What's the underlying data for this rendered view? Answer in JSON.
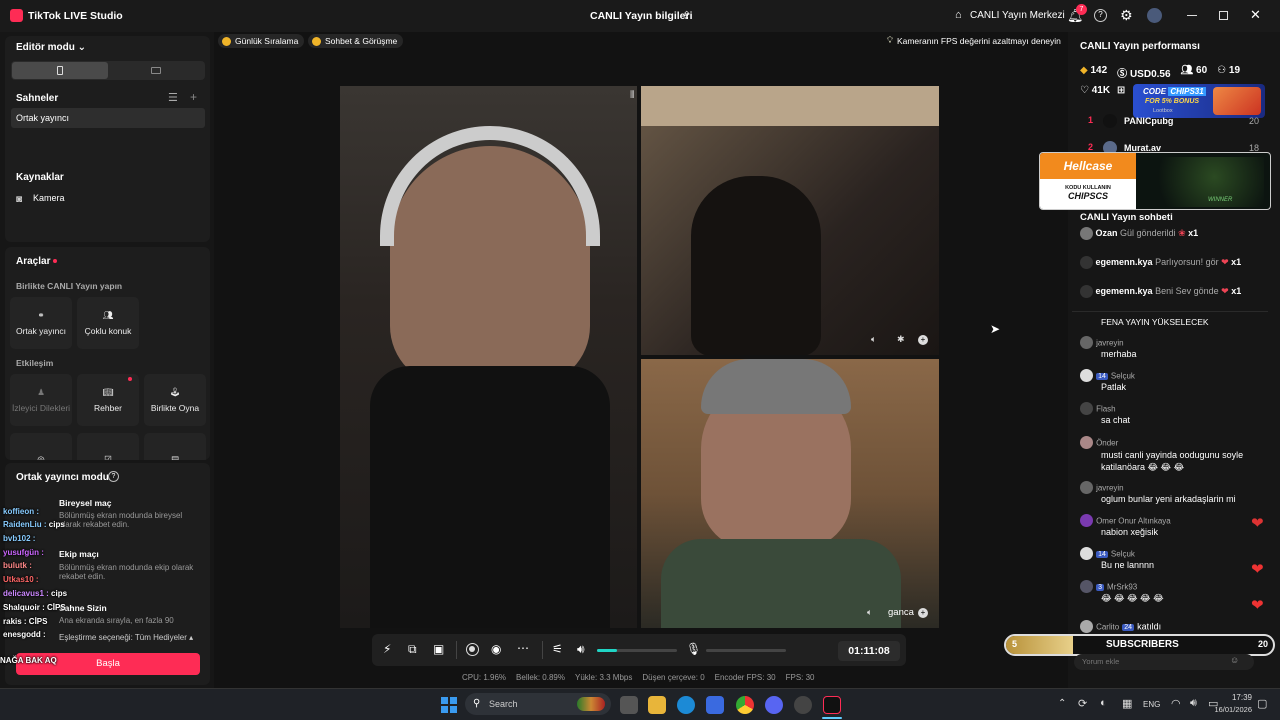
{
  "app": {
    "title": "TikTok LIVE Studio",
    "center_title": "CANLI Yayın bilgileri",
    "live_center": "CANLI Yayın Merkezi",
    "notif_count": "7"
  },
  "left": {
    "editor_mode": "Editör modu",
    "scenes_title": "Sahneler",
    "scene_item": "Ortak yayıncı",
    "sources_title": "Kaynaklar",
    "source_camera": "Kamera",
    "tools_title": "Araçlar",
    "tools_subtitle": "Birlikte CANLI Yayın yapın",
    "tool_cohost": "Ortak yayıncı",
    "tool_multi": "Çoklu konuk",
    "interaction_title": "Etkileşim",
    "tool_requests": "İzleyici Dilekleri",
    "tool_guide": "Rehber",
    "tool_play": "Birlikte Oyna",
    "cohost_mode": "Ortak yayıncı modu",
    "solo_match": "Bireysel maç",
    "solo_desc": "Bölünmüş ekran modunda bireysel olarak rekabet edin.",
    "team_match": "Ekip maçı",
    "team_desc": "Bölünmüş ekran modunda ekip olarak rekabet edin.",
    "arena": "Sahne Sizin",
    "arena_desc": "Ana ekranda sırayla, en fazla 90",
    "match_option": "Eşleştirme seçeneği: Tüm Hediyeler",
    "start": "Başla"
  },
  "overlay_chat": [
    {
      "user": "koffieon",
      "text": ""
    },
    {
      "user": "RaidenLiu",
      "text": "cips"
    },
    {
      "user": "bvb102",
      "text": ""
    },
    {
      "user": "yusufgün",
      "text": ""
    },
    {
      "user": "bulutk",
      "text": ""
    },
    {
      "user": "Utkas10",
      "text": ""
    },
    {
      "user": "delicavus1",
      "text": "cips"
    },
    {
      "user": "Shalquoir",
      "text": "CİPS"
    },
    {
      "user": "rakis",
      "text": "CİPS"
    },
    {
      "user": "enesgodd",
      "text": ""
    },
    {
      "user": "NAĞA BAK AQ",
      "text": ""
    }
  ],
  "center": {
    "chip1": "Günlük Sıralama",
    "chip2": "Sohbet & Görüşme",
    "hint": "Kameranın FPS değerini azaltmayı deneyin",
    "guest_name": "ganca",
    "timer": "01:11:08",
    "stats": [
      {
        "label": "CPU:",
        "value": "1.96%"
      },
      {
        "label": "Bellek:",
        "value": "0.89%"
      },
      {
        "label": "Yükle:",
        "value": "3.3 Mbps"
      },
      {
        "label": "Düşen çerçeve:",
        "value": "0"
      },
      {
        "label": "Encoder FPS:",
        "value": "30"
      },
      {
        "label": "FPS:",
        "value": "30"
      }
    ],
    "volume_level": 0.25
  },
  "right": {
    "perf_title": "CANLI Yayın performansı",
    "diamonds": "142",
    "usd": "USD0.56",
    "viewers": "60",
    "followers": "19",
    "likes": "41K",
    "rank": [
      {
        "n": "1",
        "name": "PANICpubg",
        "score": "20"
      },
      {
        "n": "2",
        "name": "Murat.av",
        "score": "18"
      }
    ],
    "ad1_code": "CODE",
    "ad1_codeval": "CHIPS31",
    "ad1_bonus": "FOR 5% BONUS",
    "ad1_brand": "Lootbox",
    "ad2_brand": "Hellcase",
    "ad2_line1": "KODU KULLANIN",
    "ad2_line2": "CHIPSCS",
    "ad2_win": "WINNER",
    "chat_title": "CANLI Yayın sohbeti",
    "gifts": [
      {
        "user": "Ozan",
        "text": "Gül gönderildi",
        "count": "x1"
      },
      {
        "user": "egemenn.kya",
        "text": "Parlıyorsun! gör",
        "count": "x1"
      },
      {
        "user": "egemenn.kya",
        "text": "Beni Sev gönde",
        "count": "x1"
      }
    ],
    "partial": "FENA YAYIN YÜKSELECEK",
    "messages": [
      {
        "user": "javreyin",
        "badge": "",
        "text": "merhaba"
      },
      {
        "user": "Selçuk",
        "badge": "14",
        "text": "Patlak"
      },
      {
        "user": "Flash",
        "badge": "",
        "text": "sa chat"
      },
      {
        "user": "Önder",
        "badge": "",
        "text": "musti canli yayinda oodugunu soyle katilanöara 😂 😂 😂"
      },
      {
        "user": "javreyin",
        "badge": "",
        "text": "oglum bunlar yeni arkadaşlarin mi"
      },
      {
        "user": "Omer Onur Altınkaya",
        "badge": "",
        "text": "nabion xeğisik"
      },
      {
        "user": "Selçuk",
        "badge": "14",
        "text": "Bu ne lannnn"
      },
      {
        "user": "MrSrk93",
        "badge": "3",
        "text": "😂 😂 😂 😂 😂"
      },
      {
        "user": "Carlito",
        "badge": "24",
        "text": "katıldı"
      }
    ],
    "subs_left": "5",
    "subs_label": "SUBSCRIBERS",
    "subs_right": "20",
    "comment_placeholder": "Yorum ekle"
  },
  "taskbar": {
    "search": "Search",
    "lang": "ENG",
    "time": "17:39",
    "date": "16/01/2026"
  }
}
